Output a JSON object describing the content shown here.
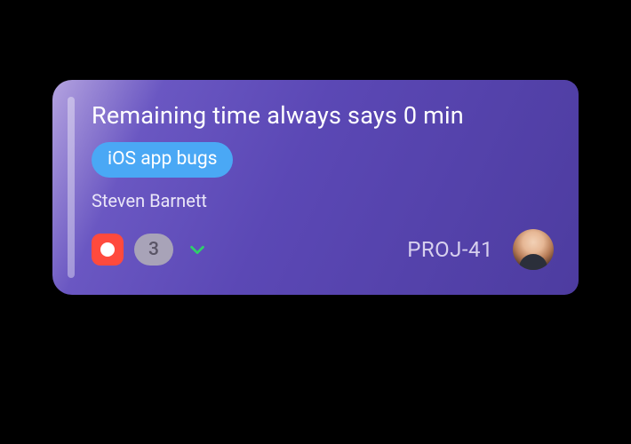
{
  "card": {
    "title": "Remaining time always says 0 min",
    "tag": "iOS app bugs",
    "author": "Steven Barnett",
    "count": "3",
    "project_id": "PROJ-41",
    "icons": {
      "record": "record-icon",
      "chevron": "chevron-down-icon"
    },
    "colors": {
      "card_gradient_start": "#b4a3e0",
      "card_gradient_end": "#4d3ca0",
      "tag_bg": "#4aa8f5",
      "record_bg": "#ff4a3d",
      "chevron": "#2fd06a"
    }
  }
}
